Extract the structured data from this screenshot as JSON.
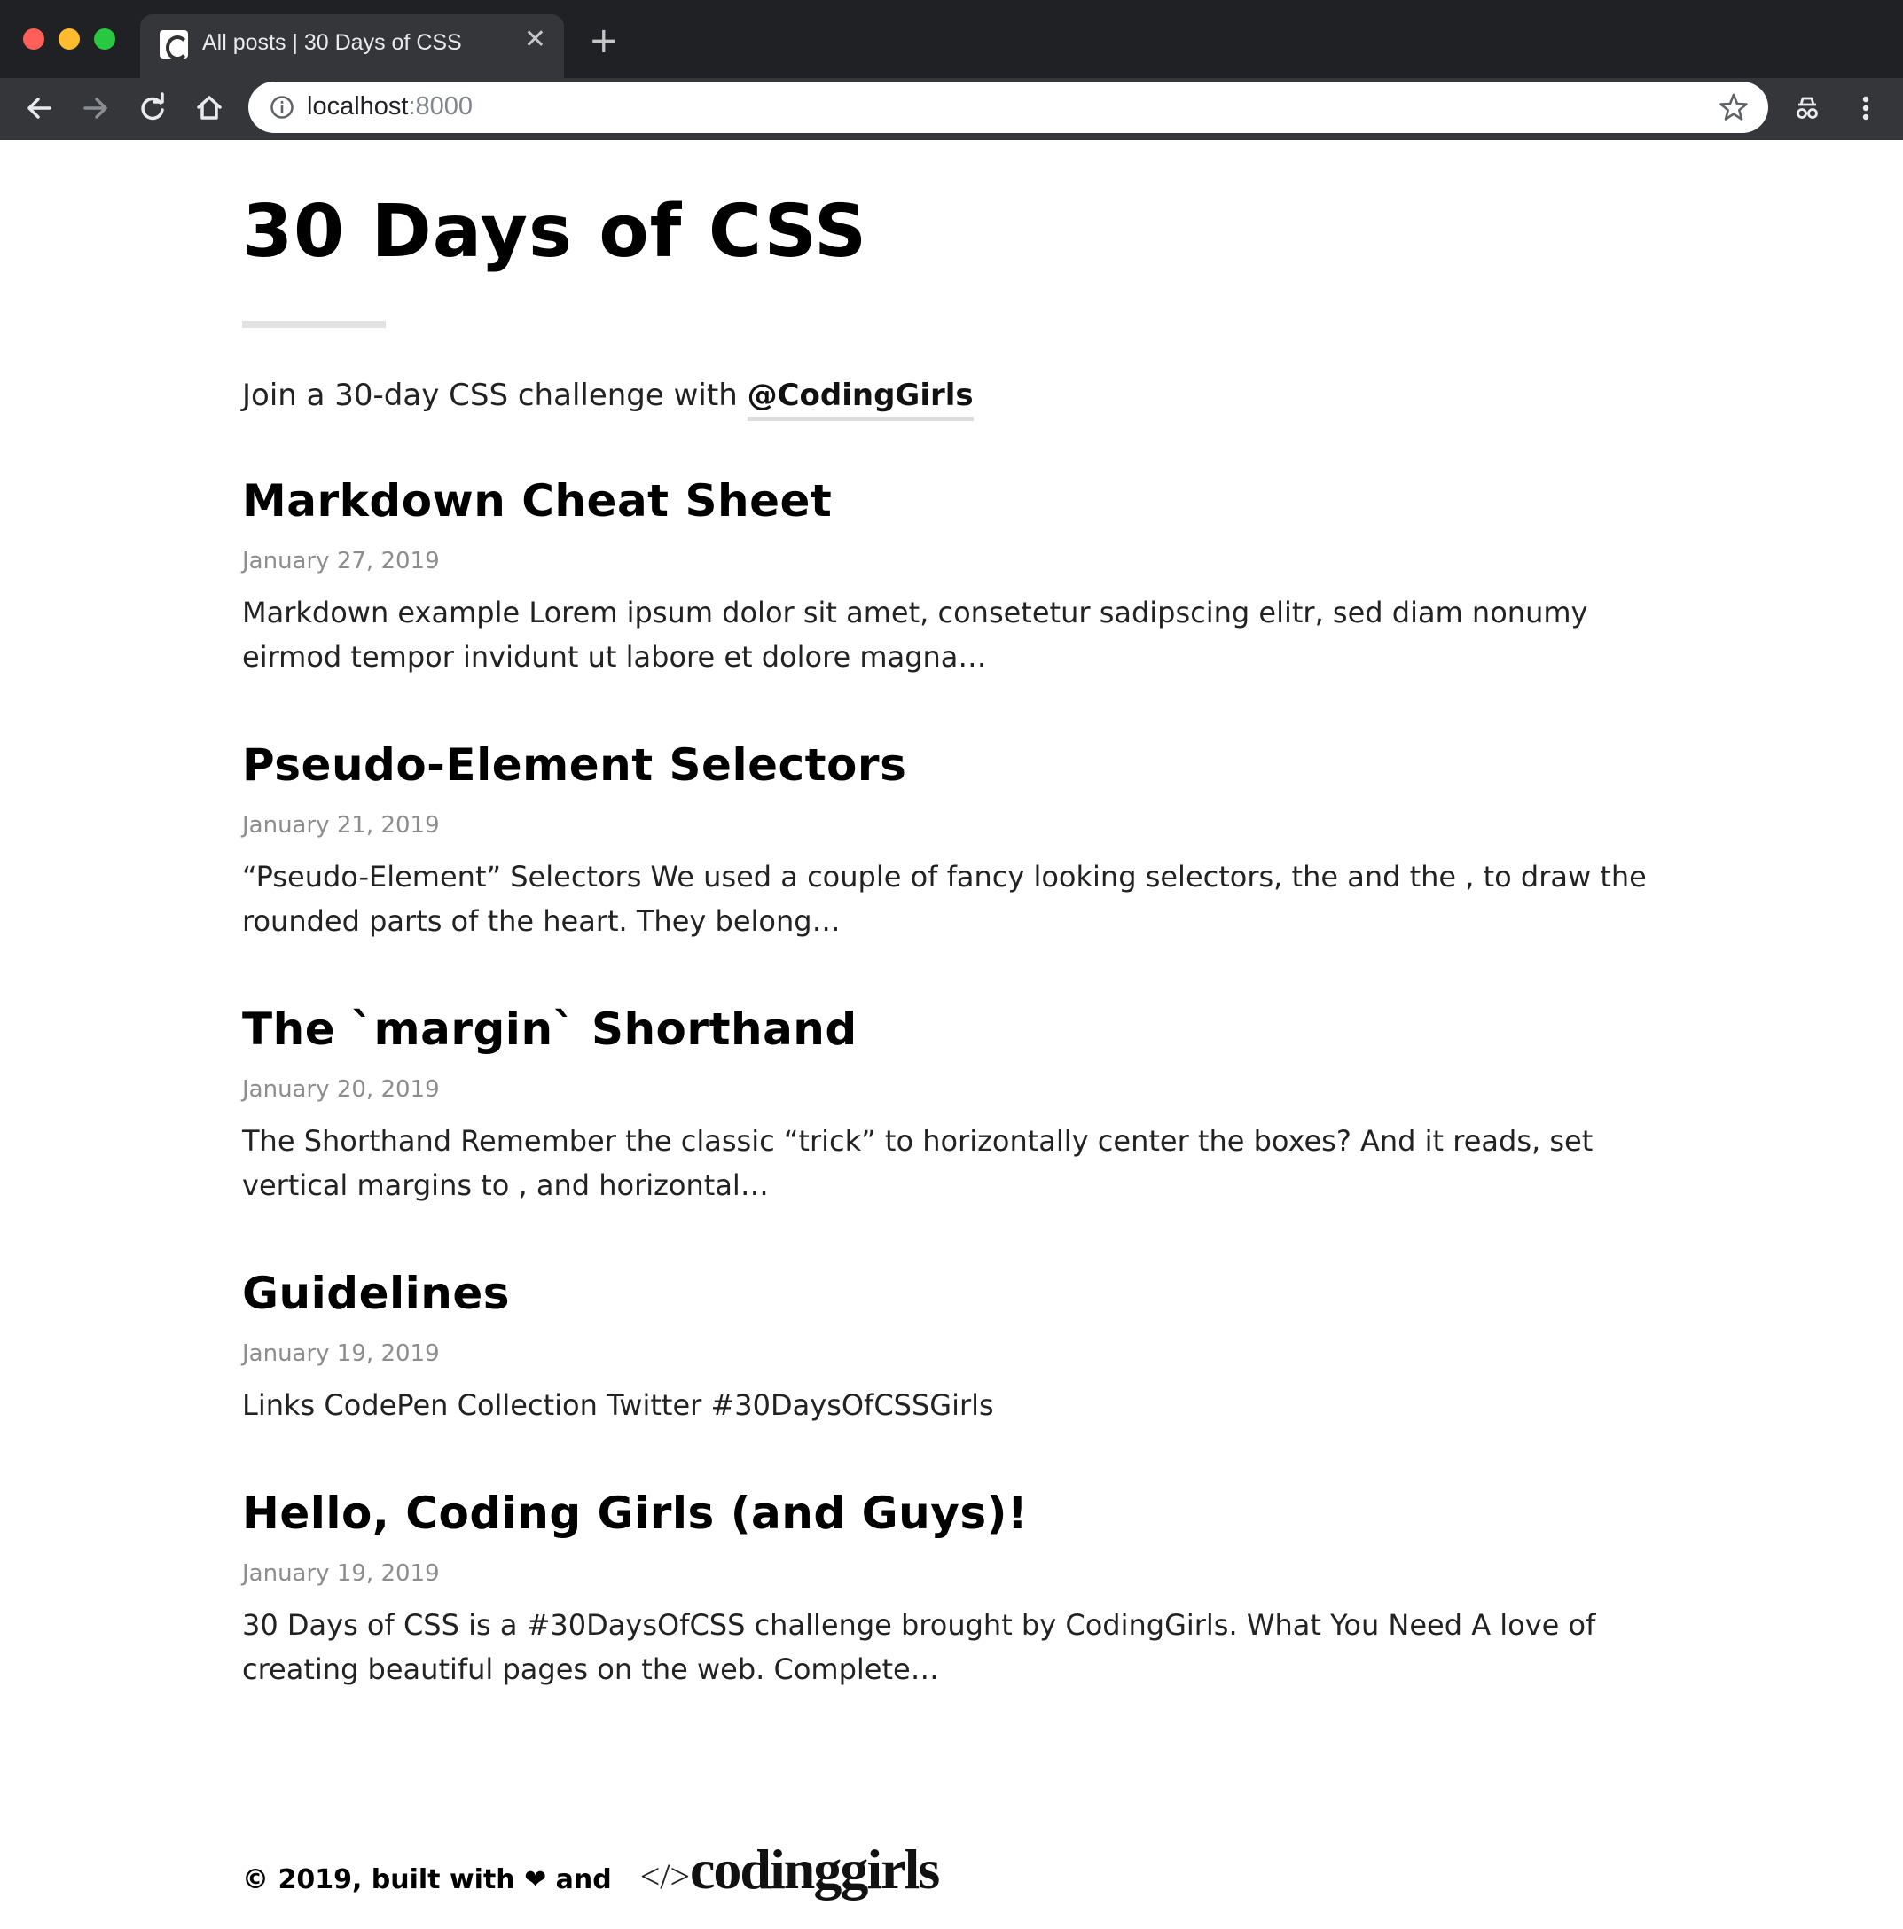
{
  "browser": {
    "tab_title": "All posts | 30 Days of CSS",
    "tab_close": "✕",
    "new_tab": "+",
    "url_host": "localhost",
    "url_port": ":8000"
  },
  "site": {
    "title": "30 Days of CSS",
    "intro_text": "Join a 30-day CSS challenge with ",
    "intro_link": "@CodingGirls"
  },
  "posts": [
    {
      "title": "Markdown Cheat Sheet",
      "date": "January 27, 2019",
      "excerpt": "Markdown example Lorem ipsum dolor sit amet, consetetur sadipscing elitr, sed diam nonumy eirmod tempor invidunt ut labore et dolore magna…"
    },
    {
      "title": "Pseudo-Element Selectors",
      "date": "January 21, 2019",
      "excerpt": "“Pseudo-Element” Selectors We used a couple of fancy looking selectors, the and the , to draw the rounded parts of the heart. They belong…"
    },
    {
      "title": "The `margin` Shorthand",
      "date": "January 20, 2019",
      "excerpt": "The Shorthand Remember the classic “trick” to horizontally center the boxes? And it reads, set vertical margins to , and horizontal…"
    },
    {
      "title": "Guidelines",
      "date": "January 19, 2019",
      "excerpt": "Links CodePen Collection Twitter #30DaysOfCSSGirls"
    },
    {
      "title": "Hello, Coding Girls (and Guys)!",
      "date": "January 19, 2019",
      "excerpt": "30 Days of CSS is a #30DaysOfCSS challenge brought by CodingGirls. What You Need A love of creating beautiful pages on the web. Complete…"
    }
  ],
  "footer": {
    "text": "© 2019, built with ❤ and",
    "brand_code": "</>",
    "brand_name": "codinggirls"
  },
  "icons": {
    "back": "back-arrow-icon",
    "forward": "forward-arrow-icon",
    "reload": "reload-icon",
    "home": "home-icon",
    "info": "info-icon",
    "bookmark": "star-icon",
    "incognito": "incognito-icon",
    "menu": "kebab-menu-icon"
  },
  "colors": {
    "chrome_dark": "#202124",
    "chrome_toolbar": "#35363a",
    "date_gray": "#8d8d8d",
    "rule_gray": "#e2e2e2"
  }
}
